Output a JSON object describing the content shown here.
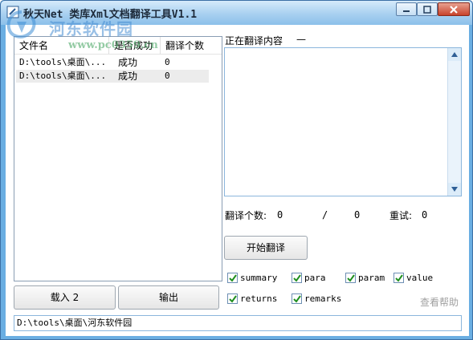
{
  "window": {
    "title": "秋天Net 类库Xml文档翻译工具V1.1"
  },
  "watermark": {
    "site_name": "河东软件园",
    "url": "www.pc0359.cn"
  },
  "file_list": {
    "columns": [
      "文件名",
      "是否成功",
      "翻译个数"
    ],
    "rows": [
      {
        "file": "D:\\tools\\桌面\\...",
        "status": "成功",
        "count": "0"
      },
      {
        "file": "D:\\tools\\桌面\\...",
        "status": "成功",
        "count": "0"
      }
    ]
  },
  "left_buttons": {
    "load_label": "载入 2",
    "export_label": "输出"
  },
  "translating": {
    "label": "正在翻译内容",
    "value": "—",
    "content": ""
  },
  "stats": {
    "count_label": "翻译个数:",
    "count_value": "0",
    "separator": "/",
    "total_value": "0",
    "retry_label": "重试:",
    "retry_value": "0"
  },
  "start_button_label": "开始翻译",
  "options": [
    {
      "label": "summary",
      "checked": true
    },
    {
      "label": "para",
      "checked": true
    },
    {
      "label": "param",
      "checked": true
    },
    {
      "label": "value",
      "checked": true
    },
    {
      "label": "returns",
      "checked": true
    },
    {
      "label": "remarks",
      "checked": true
    }
  ],
  "help_link_label": "查看帮助",
  "path_value": "D:\\tools\\桌面\\河东软件园"
}
